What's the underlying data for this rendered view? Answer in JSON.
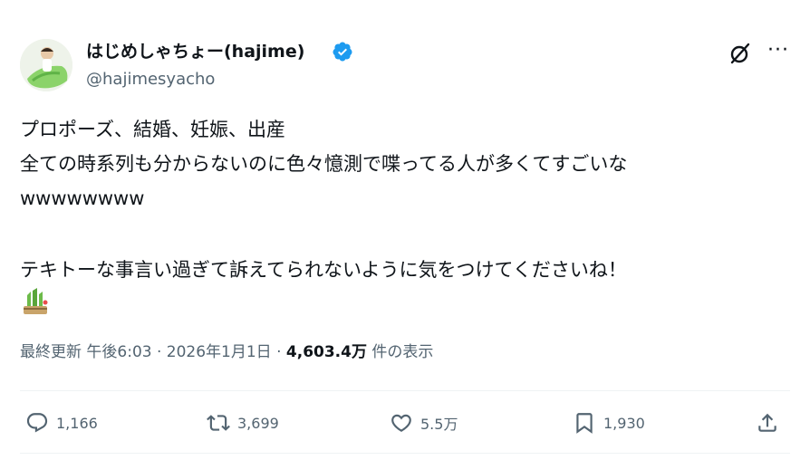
{
  "author": {
    "display_name": "はじめしゃちょー(hajime)",
    "handle": "@hajimesyacho"
  },
  "post": {
    "lines": [
      "プロポーズ、結婚、妊娠、出産",
      "全ての時系列も分からないのに色々憶測で喋ってる人が多くてすごいな",
      "wwwwwwww",
      "テキトーな事言い過ぎて訴えてられないように気をつけてくださいね！"
    ]
  },
  "meta": {
    "time": "最終更新 午後6:03 · 2026年1月1日 · ",
    "views_value": "4,603.4万",
    "views_label": " 件の表示"
  },
  "actions": {
    "replies": "1,166",
    "reposts": "3,699",
    "likes": "5.5万",
    "bookmarks": "1,930"
  },
  "colors": {
    "verified": "#1d9bf0",
    "text": "#0f1419",
    "secondary": "#536471"
  }
}
